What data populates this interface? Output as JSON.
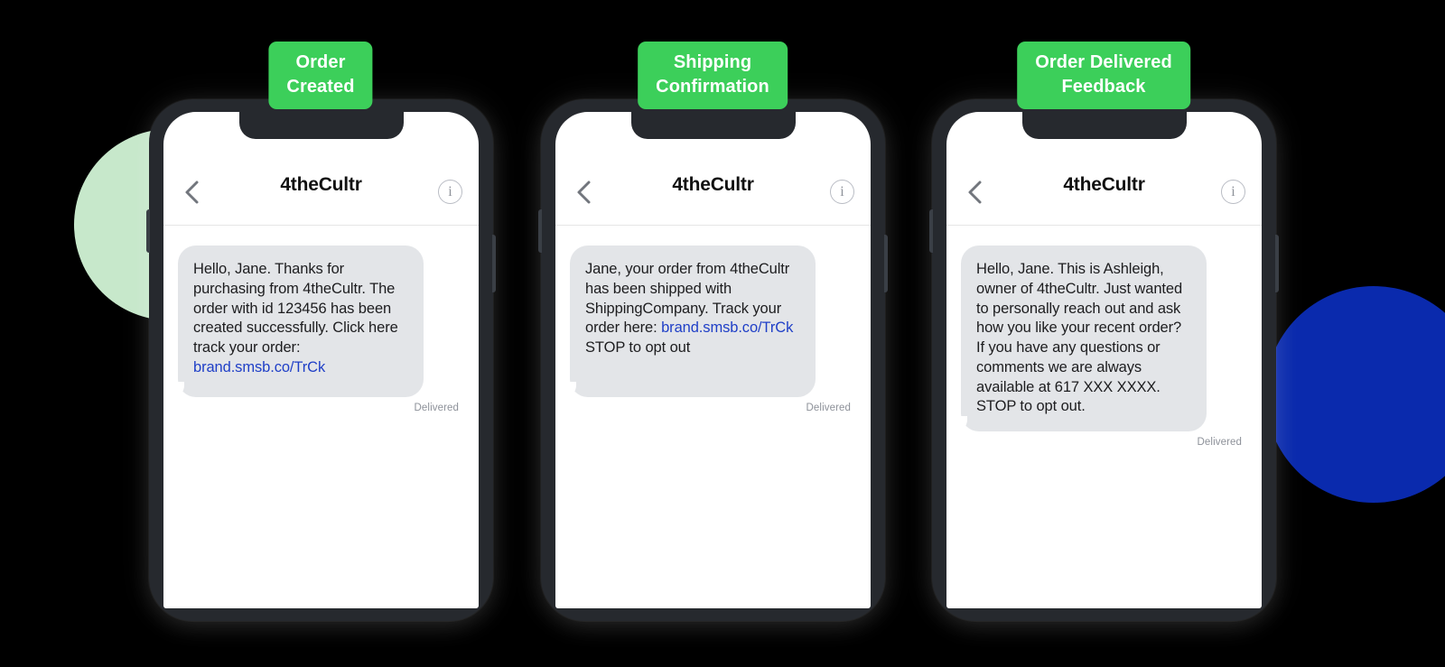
{
  "theme": {
    "background": "#000000",
    "badge_green": "#3ccf5a",
    "deco_green": "#c7e8cb",
    "deco_blue": "#0a2aad",
    "bubble_gray": "#e3e5e8",
    "link_blue": "#1f3fc7",
    "phone_frame": "#26292e"
  },
  "decorations": [
    {
      "name": "green-circle",
      "color": "#c7e8cb"
    },
    {
      "name": "blue-circle",
      "color": "#0a2aad"
    }
  ],
  "phones": [
    {
      "badge": {
        "line1": "Order",
        "line2": "Created"
      },
      "nav": {
        "back_icon": "chevron-left-icon",
        "title": "4theCultr",
        "info_icon": "info-circle-icon",
        "info_glyph": "i"
      },
      "message": {
        "body": "Hello, Jane. Thanks for purchasing from 4theCultr. The order with id 123456 has been created successfully. Click here track your order: ",
        "link": "brand.smsb.co/TrCk",
        "after_link": "",
        "status": "Delivered"
      }
    },
    {
      "badge": {
        "line1": "Shipping",
        "line2": "Confirmation"
      },
      "nav": {
        "back_icon": "chevron-left-icon",
        "title": "4theCultr",
        "info_icon": "info-circle-icon",
        "info_glyph": "i"
      },
      "message": {
        "body": "Jane, your order from 4theCultr has been shipped with ShippingCompany. Track your order here: ",
        "link": "brand.smsb.co/TrCk",
        "after_link": " STOP to opt out",
        "status": "Delivered"
      }
    },
    {
      "badge": {
        "line1": "Order Delivered",
        "line2": "Feedback"
      },
      "nav": {
        "back_icon": "chevron-left-icon",
        "title": "4theCultr",
        "info_icon": "info-circle-icon",
        "info_glyph": "i"
      },
      "message": {
        "body": "Hello, Jane. This is Ashleigh, owner of 4theCultr. Just wanted to personally reach out and ask how you like your recent order? If you have any questions or comments we are always available at 617 XXX XXXX. STOP to opt out.",
        "link": "",
        "after_link": "",
        "status": "Delivered"
      }
    }
  ]
}
